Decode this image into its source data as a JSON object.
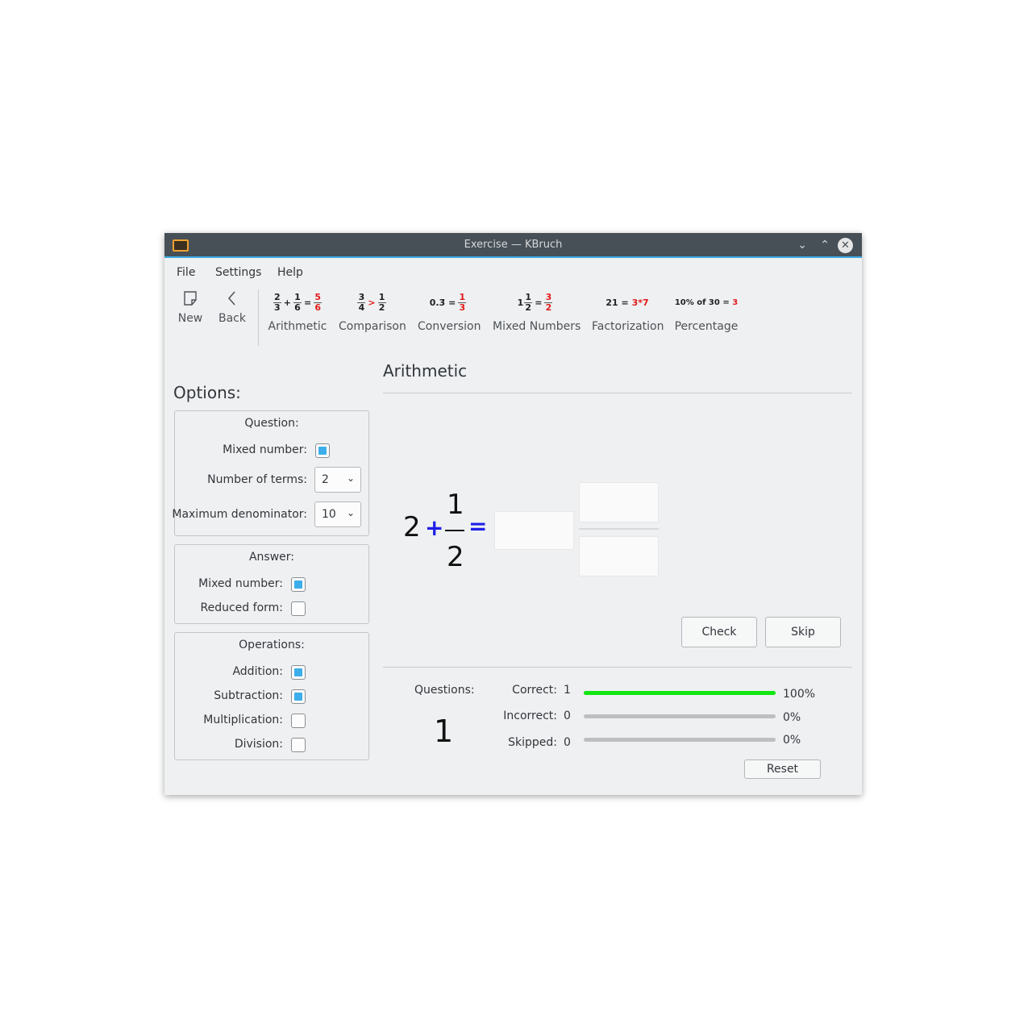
{
  "window": {
    "title": "Exercise — KBruch"
  },
  "menu": [
    "File",
    "Settings",
    "Help"
  ],
  "toolbar": {
    "new_label": "New",
    "back_label": "Back",
    "modes": [
      {
        "label": "Arithmetic"
      },
      {
        "label": "Comparison"
      },
      {
        "label": "Conversion"
      },
      {
        "label": "Mixed Numbers"
      },
      {
        "label": "Factorization"
      },
      {
        "label": "Percentage"
      }
    ],
    "icons": {
      "arith": {
        "a_num": "2",
        "a_den": "3",
        "op": "+",
        "b_num": "1",
        "b_den": "6",
        "eq": "=",
        "r_num": "5",
        "r_den": "6"
      },
      "comp": {
        "a_num": "3",
        "a_den": "4",
        "op": ">",
        "b_num": "1",
        "b_den": "2"
      },
      "conv": {
        "lhs": "0.3̄",
        "eq": "=",
        "r_num": "1",
        "r_den": "3"
      },
      "mixed": {
        "whole": "1",
        "a_num": "1",
        "a_den": "2",
        "eq": "=",
        "r_num": "3",
        "r_den": "2"
      },
      "factor": {
        "lhs": "21 =",
        "rhs": "3*7"
      },
      "percent": {
        "lhs": "10% of 30 =",
        "rhs": "3"
      }
    }
  },
  "options": {
    "title": "Options:",
    "question": {
      "title": "Question:",
      "mixed_number_label": "Mixed number:",
      "mixed_number_checked": true,
      "terms_label": "Number of terms:",
      "terms_value": "2",
      "max_den_label": "Maximum denominator:",
      "max_den_value": "10"
    },
    "answer": {
      "title": "Answer:",
      "mixed_number_label": "Mixed number:",
      "mixed_number_checked": true,
      "reduced_label": "Reduced form:",
      "reduced_checked": false
    },
    "operations": {
      "title": "Operations:",
      "addition_label": "Addition:",
      "addition_checked": true,
      "subtraction_label": "Subtraction:",
      "subtraction_checked": true,
      "multiplication_label": "Multiplication:",
      "multiplication_checked": false,
      "division_label": "Division:",
      "division_checked": false
    }
  },
  "exercise": {
    "title": "Arithmetic",
    "task": {
      "whole": "2",
      "op": "+",
      "num": "1",
      "den": "2",
      "eq": "="
    },
    "check_label": "Check",
    "skip_label": "Skip"
  },
  "stats": {
    "questions_label": "Questions:",
    "questions_count": "1",
    "correct_label": "Correct:",
    "correct_count": "1",
    "correct_pct": "100%",
    "correct_fraction": 1.0,
    "incorrect_label": "Incorrect:",
    "incorrect_count": "0",
    "incorrect_pct": "0%",
    "incorrect_fraction": 0,
    "skipped_label": "Skipped:",
    "skipped_count": "0",
    "skipped_pct": "0%",
    "skipped_fraction": 0,
    "reset_label": "Reset"
  },
  "colors": {
    "accent": "#3daee9",
    "progress": "#11e611",
    "operator": "#1f1fe8",
    "highlight": "#e21b1b"
  }
}
